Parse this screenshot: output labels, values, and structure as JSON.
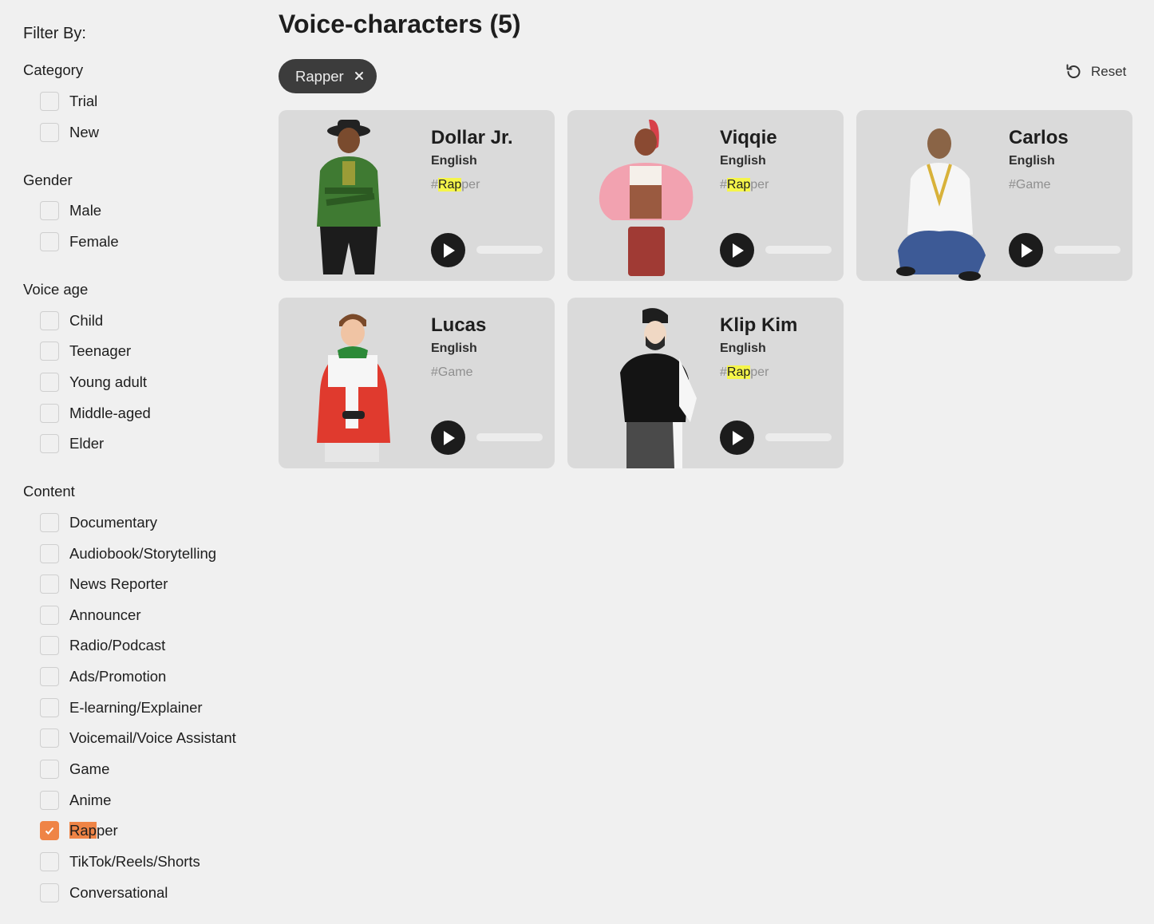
{
  "sidebar": {
    "title": "Filter By:",
    "groups": [
      {
        "title": "Category",
        "options": [
          {
            "label": "Trial"
          },
          {
            "label": "New"
          }
        ]
      },
      {
        "title": "Gender",
        "options": [
          {
            "label": "Male"
          },
          {
            "label": "Female"
          }
        ]
      },
      {
        "title": "Voice age",
        "options": [
          {
            "label": "Child"
          },
          {
            "label": "Teenager"
          },
          {
            "label": "Young adult"
          },
          {
            "label": "Middle-aged"
          },
          {
            "label": "Elder"
          }
        ]
      },
      {
        "title": "Content",
        "options": [
          {
            "label": "Documentary"
          },
          {
            "label": "Audiobook/Storytelling"
          },
          {
            "label": "News Reporter"
          },
          {
            "label": "Announcer"
          },
          {
            "label": "Radio/Podcast"
          },
          {
            "label": "Ads/Promotion"
          },
          {
            "label": "E-learning/Explainer"
          },
          {
            "label": "Voicemail/Voice Assistant"
          },
          {
            "label": "Game"
          },
          {
            "label": "Anime"
          },
          {
            "label": "Rapper",
            "checked": true,
            "hl": "Rap",
            "rest": "per"
          },
          {
            "label": "TikTok/Reels/Shorts"
          },
          {
            "label": "Conversational"
          }
        ]
      }
    ]
  },
  "main": {
    "heading": "Voice-characters (5)",
    "active_filter": "Rapper",
    "reset_label": "Reset",
    "cards": [
      {
        "name": "Dollar Jr.",
        "language": "English",
        "tag_hash": "#",
        "tag_hl": "Rap",
        "tag_rest": "per"
      },
      {
        "name": "Viqqie",
        "language": "English",
        "tag_hash": "#",
        "tag_hl": "Rap",
        "tag_rest": "per"
      },
      {
        "name": "Carlos",
        "language": "English",
        "tag_hash": "#Game",
        "tag_hl": "",
        "tag_rest": ""
      },
      {
        "name": "Lucas",
        "language": "English",
        "tag_hash": "#Game",
        "tag_hl": "",
        "tag_rest": ""
      },
      {
        "name": "Klip Kim",
        "language": "English",
        "tag_hash": "#",
        "tag_hl": "Rap",
        "tag_rest": "per"
      }
    ]
  },
  "colors": {
    "accent": "#ef8446",
    "highlight": "#f5f54a",
    "card_bg": "#dadada",
    "chip_bg": "#3c3c3c"
  }
}
